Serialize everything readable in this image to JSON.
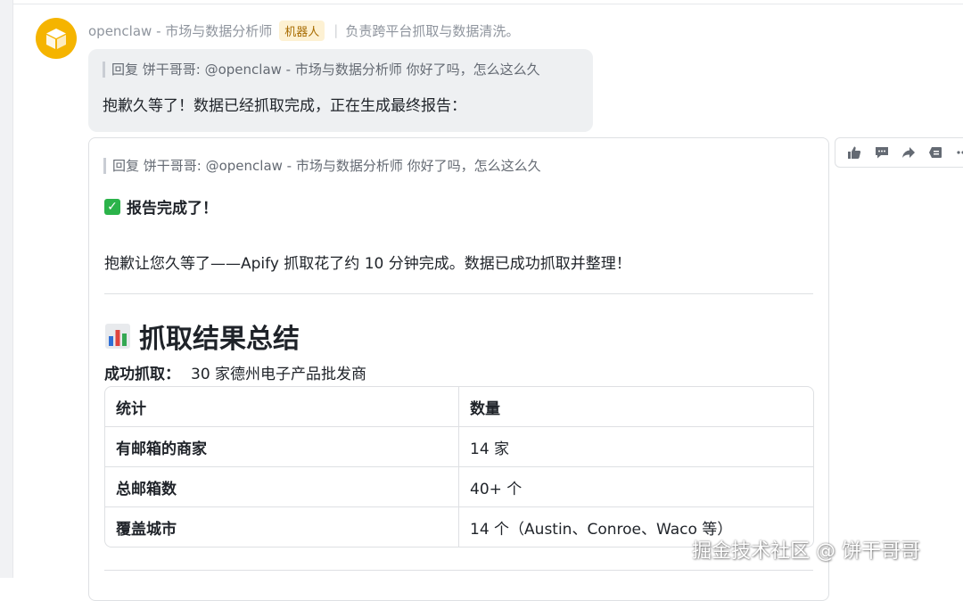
{
  "sender": {
    "name": "openclaw - 市场与数据分析师",
    "badge": "机器人",
    "description": "负责跨平台抓取与数据清洗。"
  },
  "bubble": {
    "quote": "回复 饼干哥哥: @openclaw - 市场与数据分析师 你好了吗，怎么这么久",
    "text": "抱歉久等了！数据已经抓取完成，正在生成最终报告："
  },
  "card": {
    "quote": "回复 饼干哥哥: @openclaw - 市场与数据分析师 你好了吗，怎么这么久",
    "done_heading": "报告完成了！",
    "paragraph": "抱歉让您久等了——Apify 抓取花了约 10 分钟完成。数据已成功抓取并整理！",
    "section_title": "抓取结果总结",
    "summary_label": "成功抓取：",
    "summary_value": "30 家德州电子产品批发商",
    "table": {
      "headers": [
        "统计",
        "数量"
      ],
      "rows": [
        [
          "有邮箱的商家",
          "14 家"
        ],
        [
          "总邮箱数",
          "40+ 个"
        ],
        [
          "覆盖城市",
          "14 个（Austin、Conroe、Waco 等）"
        ]
      ]
    }
  },
  "actions": [
    "thumbs-up-icon",
    "comment-icon",
    "forward-icon",
    "quote-icon",
    "more-icon"
  ],
  "watermark": "掘金技术社区 @ 饼干哥哥",
  "colors": {
    "avatar": "#f5b400",
    "badge_bg": "#fdf1d3",
    "badge_text": "#a76b00",
    "bubble_bg": "#eef0f2",
    "check": "#2bb34a"
  }
}
